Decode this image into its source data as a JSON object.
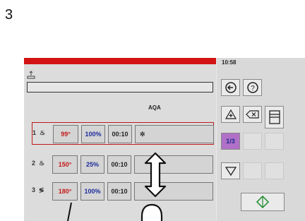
{
  "page_number": "3",
  "status": {
    "clock": "10:58"
  },
  "program": {
    "name": "AQA"
  },
  "rows": [
    {
      "index": "1",
      "temp": "99°",
      "humidity": "100%",
      "time": "00:10"
    },
    {
      "index": "2",
      "temp": "150°",
      "humidity": "25%",
      "time": "00:10"
    },
    {
      "index": "3",
      "temp": "180°",
      "humidity": "100%",
      "time": "00:10"
    }
  ],
  "pager": {
    "label": "1/3"
  },
  "colors": {
    "accent_red": "#d21414",
    "selection": "#b070c8",
    "humidity_blue": "#1c2c9c"
  },
  "icons": [
    "pen-icon",
    "back-icon",
    "help-icon",
    "add-step-icon",
    "delete-icon",
    "save-icon",
    "scroll-down-icon",
    "start-icon",
    "steam-icon",
    "arrow-vertical-icon"
  ]
}
